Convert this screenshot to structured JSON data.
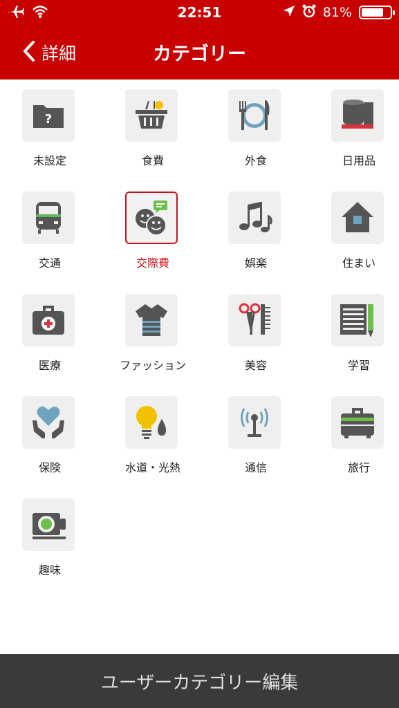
{
  "status_bar": {
    "time": "22:51",
    "battery": "81%",
    "battery_level": 0.81,
    "icons": [
      "airplane-icon",
      "wifi-icon",
      "location-arrow-icon",
      "alarm-icon",
      "battery-icon"
    ]
  },
  "navbar": {
    "back_label": "詳細",
    "title": "カテゴリー",
    "color": "#c80000"
  },
  "categories": [
    {
      "label": "未設定",
      "icon": "folder-question-icon"
    },
    {
      "label": "食費",
      "icon": "basket-icon"
    },
    {
      "label": "外食",
      "icon": "fork-knife-plate-icon"
    },
    {
      "label": "日用品",
      "icon": "toilet-paper-icon"
    },
    {
      "label": "交通",
      "icon": "train-icon"
    },
    {
      "label": "交際費",
      "icon": "friends-chat-icon",
      "selected": true
    },
    {
      "label": "娯楽",
      "icon": "music-notes-icon"
    },
    {
      "label": "住まい",
      "icon": "house-icon"
    },
    {
      "label": "医療",
      "icon": "medical-bag-icon"
    },
    {
      "label": "ファッション",
      "icon": "tshirt-icon"
    },
    {
      "label": "美容",
      "icon": "scissors-comb-icon"
    },
    {
      "label": "学習",
      "icon": "notebook-pencil-icon"
    },
    {
      "label": "保険",
      "icon": "heart-hands-icon"
    },
    {
      "label": "水道・光熱",
      "icon": "bulb-drop-icon"
    },
    {
      "label": "通信",
      "icon": "antenna-icon"
    },
    {
      "label": "旅行",
      "icon": "suitcase-icon"
    },
    {
      "label": "趣味",
      "icon": "camera-icon"
    }
  ],
  "selected_color": "#d0101a",
  "footer": {
    "label": "ユーザーカテゴリー編集"
  }
}
